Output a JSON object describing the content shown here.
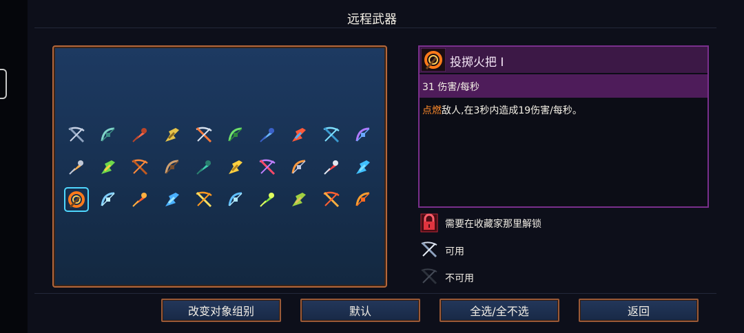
{
  "header": {
    "title": "远程武器"
  },
  "grid": {
    "rows": [
      [
        "crossbow-icon",
        "multi-crossbow-icon",
        "bow-icon",
        "repeater-icon",
        "ice-bow-icon",
        "nature-bow-icon",
        "heavy-crossbow-icon",
        "fire-crossbow-icon",
        "sonic-crossbow-icon",
        "ice-crossbow-icon"
      ],
      [
        "explosive-crossbow-icon",
        "alchemic-carbine-icon",
        "boomerang-icon",
        "pickaxe-icon",
        "war-javelin-icon",
        "spear-icon",
        "magic-missile-icon",
        "throwing-axe-icon",
        "throwing-knife-icon",
        "whip-icon"
      ],
      [
        "fire-torch-icon",
        "ice-shards-icon",
        "fireball-icon",
        "lightning-icon",
        "fire-blast-icon",
        "frost-blast-icon",
        "poison-darts-icon",
        "flute-icon",
        "dragon-bow-icon",
        "golden-bow-icon"
      ]
    ],
    "selected": "fire-torch-icon"
  },
  "detail": {
    "name": "投掷火把 I",
    "dps": "31 伤害/每秒",
    "desc_keyword": "点燃",
    "desc_rest": "敌人,在3秒内造成19伤害/每秒。"
  },
  "legend": {
    "locked": "需要在收藏家那里解锁",
    "available": "可用",
    "unavailable": "不可用"
  },
  "buttons": {
    "change_group": "改变对象组别",
    "default": "默认",
    "select_all": "全选/全不选",
    "back": "返回"
  },
  "colors": {
    "panel_border": "#b5673a",
    "detail_border": "#7a2f8c",
    "selection": "#4fd7ff",
    "keyword": "#ff8a2a"
  }
}
